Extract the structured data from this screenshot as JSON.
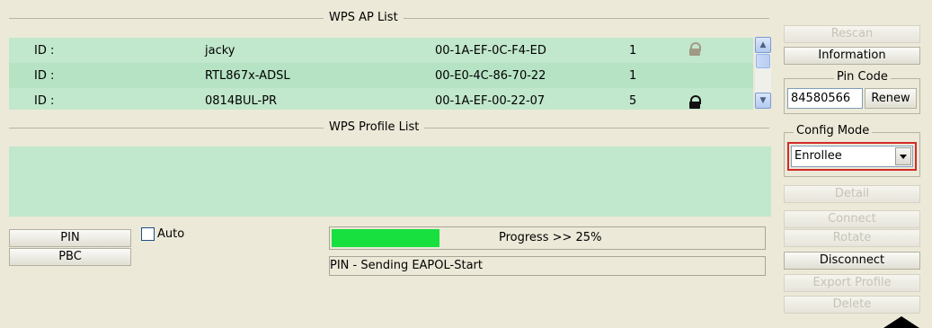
{
  "ap_list": {
    "title": "WPS AP List",
    "rows": [
      {
        "id_label": "ID :",
        "ssid": "jacky",
        "mac": "00-1A-EF-0C-F4-ED",
        "channel": "1"
      },
      {
        "id_label": "ID :",
        "ssid": "RTL867x-ADSL",
        "mac": "00-E0-4C-86-70-22",
        "channel": "1"
      },
      {
        "id_label": "ID :",
        "ssid": "0814BUL-PR",
        "mac": "00-1A-EF-00-22-07",
        "channel": "5"
      }
    ],
    "scroll_up_icon": "scroll-up-arrow",
    "scroll_down_icon": "scroll-down-arrow"
  },
  "profile_list": {
    "title": "WPS Profile List"
  },
  "controls": {
    "pin_label": "PIN",
    "pbc_label": "PBC",
    "auto_label": "Auto",
    "progress_text": "Progress >> 25%",
    "progress_percent": 25,
    "status_text": "PIN - Sending EAPOL-Start"
  },
  "side": {
    "rescan": "Rescan",
    "information": "Information",
    "pin_code_label": "Pin Code",
    "pin_code_value": "84580566",
    "renew": "Renew",
    "config_mode_label": "Config Mode",
    "config_mode_value": "Enrollee",
    "detail": "Detail",
    "connect": "Connect",
    "rotate": "Rotate",
    "disconnect": "Disconnect",
    "export_profile": "Export Profile",
    "delete": "Delete"
  },
  "colors": {
    "list_background": "#c1e7cc",
    "progress_fill": "#18e03f",
    "highlight_border": "#d32a2a"
  }
}
